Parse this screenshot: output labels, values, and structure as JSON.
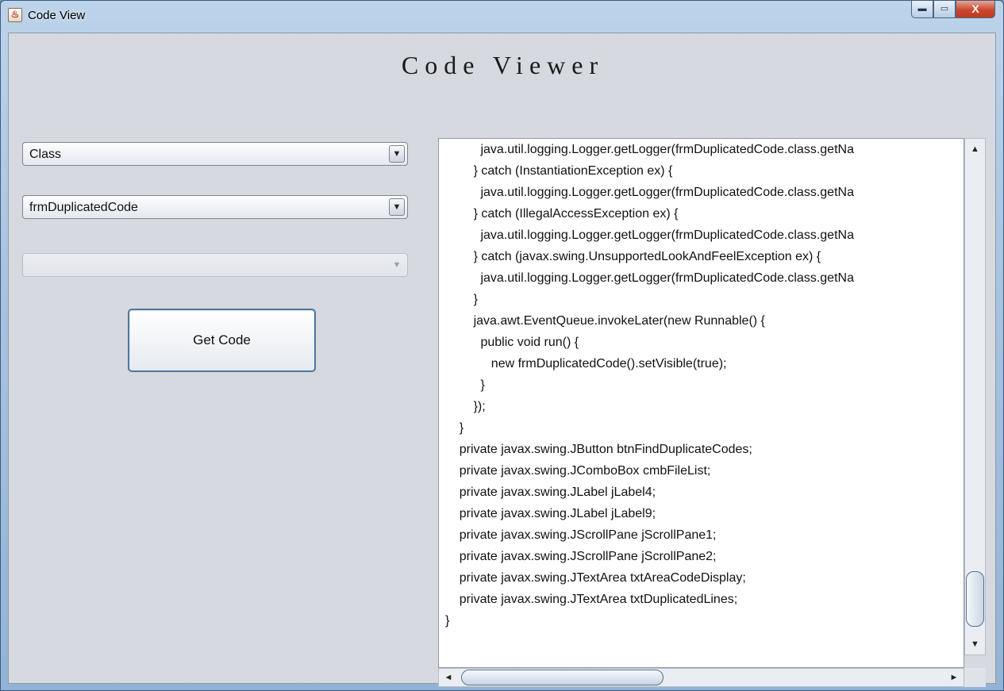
{
  "window": {
    "title": "Code View",
    "minimize_symbol": "▬",
    "maximize_symbol": "▭",
    "close_symbol": "X"
  },
  "app": {
    "heading": "Code Viewer"
  },
  "form": {
    "type_combo": {
      "selected": "Class",
      "arrow": "▼"
    },
    "file_combo": {
      "selected": "frmDuplicatedCode",
      "arrow": "▼"
    },
    "member_combo": {
      "selected": "",
      "arrow": "▼",
      "enabled": false
    },
    "get_code_label": "Get Code"
  },
  "code_view": {
    "lines": [
      "          java.util.logging.Logger.getLogger(frmDuplicatedCode.class.getNa",
      "        } catch (InstantiationException ex) {",
      "          java.util.logging.Logger.getLogger(frmDuplicatedCode.class.getNa",
      "        } catch (IllegalAccessException ex) {",
      "          java.util.logging.Logger.getLogger(frmDuplicatedCode.class.getNa",
      "        } catch (javax.swing.UnsupportedLookAndFeelException ex) {",
      "          java.util.logging.Logger.getLogger(frmDuplicatedCode.class.getNa",
      "        }",
      "        java.awt.EventQueue.invokeLater(new Runnable() {",
      "          public void run() {",
      "             new frmDuplicatedCode().setVisible(true);",
      "          }",
      "        });",
      "    }",
      "    private javax.swing.JButton btnFindDuplicateCodes;",
      "    private javax.swing.JComboBox cmbFileList;",
      "    private javax.swing.JLabel jLabel4;",
      "    private javax.swing.JLabel jLabel9;",
      "    private javax.swing.JScrollPane jScrollPane1;",
      "    private javax.swing.JScrollPane jScrollPane2;",
      "    private javax.swing.JTextArea txtAreaCodeDisplay;",
      "    private javax.swing.JTextArea txtDuplicatedLines;",
      "}"
    ],
    "scroll_up": "▲",
    "scroll_down": "▼",
    "scroll_left": "◄",
    "scroll_right": "►"
  }
}
